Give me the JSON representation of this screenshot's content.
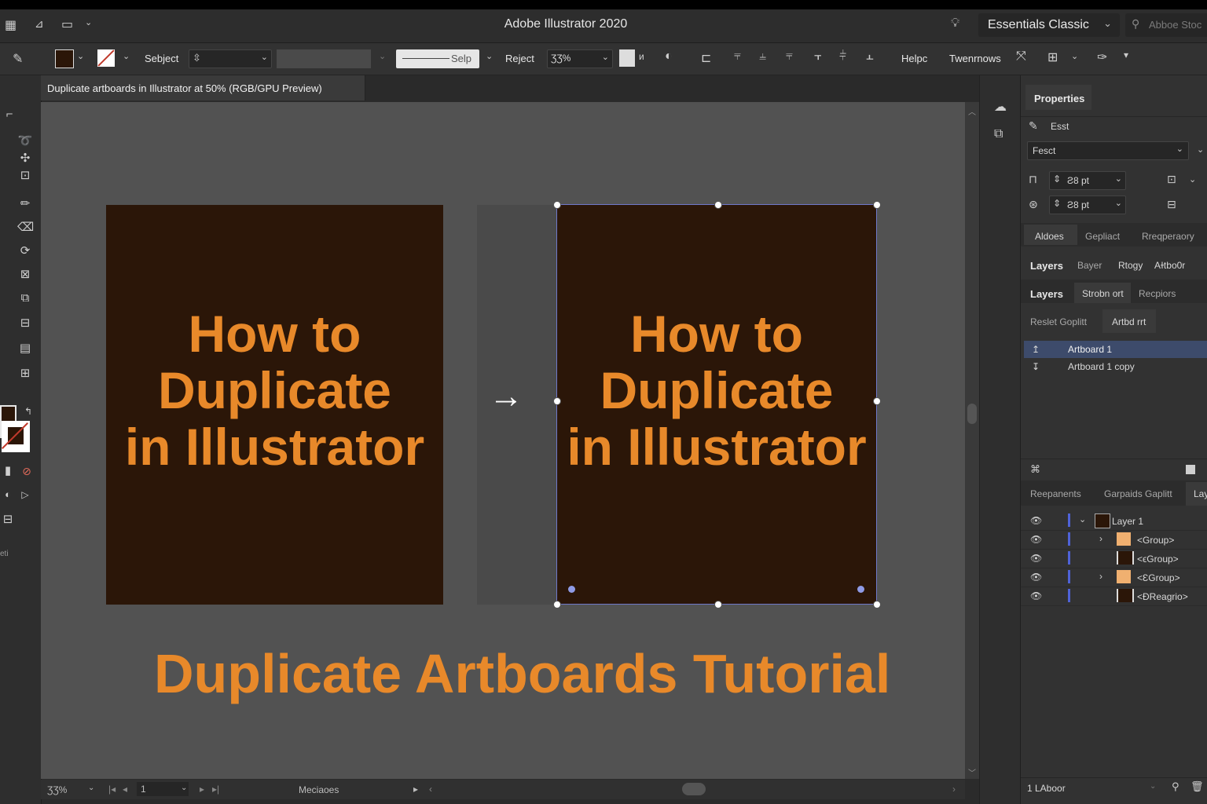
{
  "app": {
    "title": "Adobe Illustrator 2020",
    "workspace": "Essentials Classic",
    "stock_search_placeholder": "Abboe Stoc"
  },
  "control_bar": {
    "select_label": "Sebject",
    "stroke_style_label": "Selp",
    "reject_label": "Reject",
    "reject_value": "ƷƷ%",
    "help_label": "Helpc",
    "transform_label": "Twenrnows"
  },
  "document": {
    "tab_title": "Duplicate artboards in Illustrator at 50% (RGB/GPU Preview)"
  },
  "canvas": {
    "artboard_headline": [
      "How to",
      "Duplicate",
      "in Illustrator"
    ],
    "arrow": "→",
    "tutorial_title": "Duplicate Artboards Tutorial",
    "colors": {
      "artboard_fill": "#2b1608",
      "text_orange": "#e8892a",
      "canvas_bg": "#525252",
      "selection": "#6f78c9"
    }
  },
  "status_bar": {
    "zoom": "ƷƷ%",
    "artboard_number": "1",
    "center_label": "Meciaoes"
  },
  "properties_panel": {
    "tab": "Properties",
    "row1_label": "Esst",
    "dropdown_value": "Fesct",
    "w_value": "Ƨ8 pt",
    "h_value": "Ƨ8 pt",
    "subtabs_a": [
      "Aldoes",
      "Gepliact",
      "Rreqperaory"
    ],
    "subtabs_b": [
      "Layers",
      "Bayer",
      "Rtogy",
      "Aɫtbo0r"
    ],
    "subtabs_c": [
      "Layers",
      "Strobn ort",
      "Recpiors"
    ],
    "subtabs_d": [
      "Reslet Goplitt",
      "Artbd rrt"
    ],
    "artboards": [
      "Artboard 1",
      "Artboard 1 copy"
    ],
    "bottom_tabs": [
      "Reepanents",
      "Garpaids Gaplitt",
      "Lay"
    ],
    "layers": [
      {
        "name": "Layer 1",
        "expanded": true
      },
      {
        "name": "<Group>",
        "expandable": true
      },
      {
        "name": "<ϵGroup>",
        "expandable": false
      },
      {
        "name": "<ƐGroup>",
        "expandable": true
      },
      {
        "name": "<ĐReagrio>",
        "expandable": false
      }
    ],
    "footer_label": "1 LAboor"
  },
  "icons": [
    "home-icon",
    "arrange-icon",
    "layout-icon",
    "lightbulb-icon",
    "search-icon",
    "brush-icon",
    "arrow-right-icon",
    "eye-icon",
    "chevron-down-icon",
    "chevron-right-icon",
    "trash-icon",
    "new-layer-icon"
  ]
}
